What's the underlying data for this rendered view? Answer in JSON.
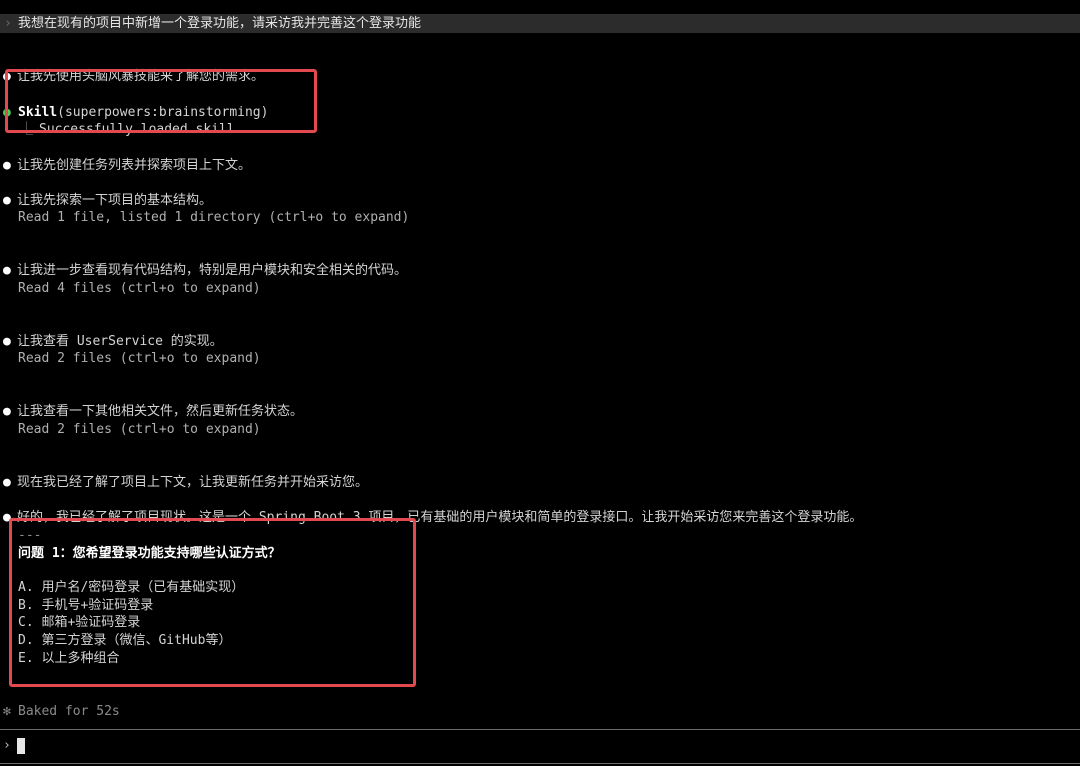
{
  "prompt": {
    "chevron": "›",
    "text": "我想在现有的项目中新增一个登录功能，请采访我并完善这个登录功能"
  },
  "messages": [
    {
      "bullet": "●",
      "text": "让我先使用头脑风暴技能来了解您的需求。"
    },
    {
      "bullet": "●",
      "text": "让我先创建任务列表并探索项目上下文。"
    },
    {
      "bullet": "●",
      "text": "让我先探索一下项目的基本结构。"
    },
    {
      "bullet": "●",
      "text": "让我进一步查看现有代码结构，特别是用户模块和安全相关的代码。"
    },
    {
      "bullet": "●",
      "text": "让我查看 UserService 的实现。"
    },
    {
      "bullet": "●",
      "text": "让我查看一下其他相关文件，然后更新任务状态。"
    },
    {
      "bullet": "●",
      "text": "现在我已经了解了项目上下文，让我更新任务并开始采访您。"
    },
    {
      "bullet": "●",
      "text": "好的，我已经了解了项目现状。这是一个 Spring Boot 3 项目，已有基础的用户模块和简单的登录接口。让我开始采访您来完善这个登录功能。"
    }
  ],
  "skill": {
    "bullet": "●",
    "name": "Skill",
    "args": "(superpowers:brainstorming)",
    "result_prefix": "⎿",
    "result": "Successfully loaded skill"
  },
  "tool_results": [
    "Read 1 file, listed 1 directory (ctrl+o to expand)",
    "Read 4 files (ctrl+o to expand)",
    "Read 2 files (ctrl+o to expand)",
    "Read 2 files (ctrl+o to expand)"
  ],
  "question": {
    "separator": "---",
    "title": "问题 1：您希望登录功能支持哪些认证方式？",
    "options": [
      "A. 用户名/密码登录（已有基础实现）",
      "B. 手机号+验证码登录",
      "C. 邮箱+验证码登录",
      "D. 第三方登录（微信、GitHub等）",
      "E. 以上多种组合"
    ]
  },
  "status": {
    "icon": "✻",
    "text": "Baked for 52s"
  },
  "input": {
    "chevron": "›",
    "value": ""
  },
  "colors": {
    "highlight_box": "#e34a4f",
    "skill_bullet": "#4ec95a",
    "background": "#000000"
  }
}
